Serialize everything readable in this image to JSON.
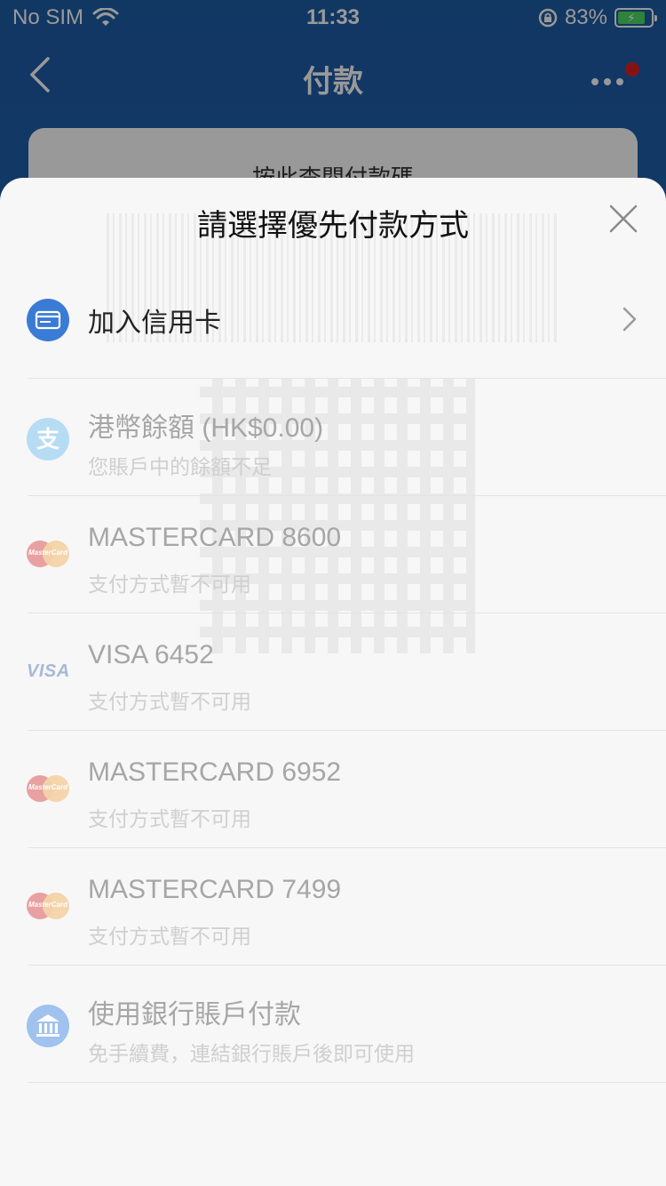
{
  "status_bar": {
    "carrier": "No SIM",
    "time": "11:33",
    "battery": "83%"
  },
  "nav": {
    "back_icon": "chevron-left-icon",
    "title": "付款",
    "more_icon": "more-dots-icon"
  },
  "background": {
    "card_hint": "按此查閱付款碼"
  },
  "sheet": {
    "title": "請選擇優先付款方式",
    "close_icon": "close-icon",
    "add_card": {
      "label": "加入信用卡",
      "icon": "credit-card-icon"
    },
    "methods": [
      {
        "name": "港幣餘額 (HK$0.00)",
        "note": "您賬戶中的餘額不足",
        "icon": "alipay-icon"
      },
      {
        "name": "MASTERCARD 8600",
        "note": "支付方式暫不可用",
        "icon": "mastercard-icon"
      },
      {
        "name": "VISA 6452",
        "note": "支付方式暫不可用",
        "icon": "visa-icon"
      },
      {
        "name": "MASTERCARD 6952",
        "note": "支付方式暫不可用",
        "icon": "mastercard-icon"
      },
      {
        "name": "MASTERCARD 7499",
        "note": "支付方式暫不可用",
        "icon": "mastercard-icon"
      },
      {
        "name": "使用銀行賬戶付款",
        "note": "免手續費，連結銀行賬戶後即可使用",
        "icon": "bank-icon"
      }
    ],
    "brand_labels": {
      "mastercard": "MasterCard",
      "visa": "VISA"
    }
  },
  "colors": {
    "accent_blue": "#3a7bd5",
    "alipay_blue": "#5ab3e8",
    "sheet_bg": "#f7f7f7"
  }
}
